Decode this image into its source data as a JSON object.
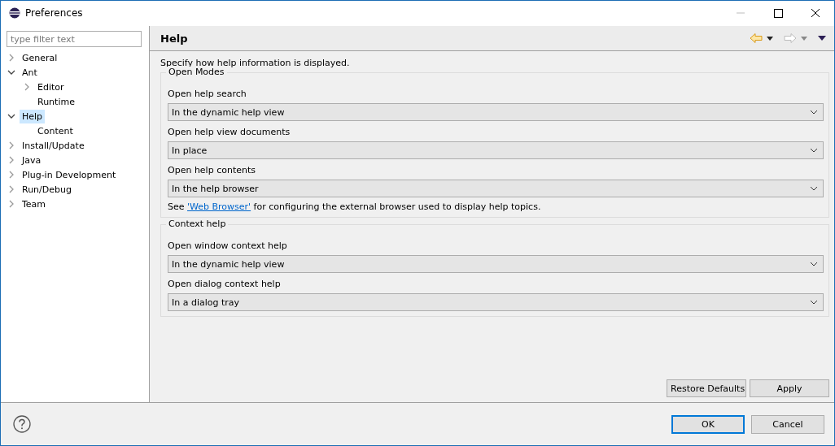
{
  "window": {
    "title": "Preferences"
  },
  "filter": {
    "placeholder": "type filter text"
  },
  "tree": [
    {
      "label": "General",
      "expandable": true,
      "expanded": false,
      "selected": false
    },
    {
      "label": "Ant",
      "expandable": true,
      "expanded": true,
      "selected": false,
      "children": [
        {
          "label": "Editor",
          "expandable": true,
          "expanded": false,
          "selected": false
        },
        {
          "label": "Runtime",
          "expandable": false,
          "expanded": false,
          "selected": false
        }
      ]
    },
    {
      "label": "Help",
      "expandable": true,
      "expanded": true,
      "selected": true,
      "children": [
        {
          "label": "Content",
          "expandable": false,
          "expanded": false,
          "selected": false
        }
      ]
    },
    {
      "label": "Install/Update",
      "expandable": true,
      "expanded": false,
      "selected": false
    },
    {
      "label": "Java",
      "expandable": true,
      "expanded": false,
      "selected": false
    },
    {
      "label": "Plug-in Development",
      "expandable": true,
      "expanded": false,
      "selected": false
    },
    {
      "label": "Run/Debug",
      "expandable": true,
      "expanded": false,
      "selected": false
    },
    {
      "label": "Team",
      "expandable": true,
      "expanded": false,
      "selected": false
    }
  ],
  "page": {
    "title": "Help",
    "description": "Specify how help information is displayed.",
    "groups": [
      {
        "legend": "Open Modes",
        "fields": [
          {
            "label": "Open help search",
            "value": "In the dynamic help view"
          },
          {
            "label": "Open help view documents",
            "value": "In place"
          },
          {
            "label": "Open help contents",
            "value": "In the help browser"
          }
        ],
        "note": {
          "before": "See ",
          "link": "'Web Browser'",
          "after": " for configuring the external browser used to display help topics."
        }
      },
      {
        "legend": "Context help",
        "fields": [
          {
            "label": "Open window context help",
            "value": "In the dynamic help view"
          },
          {
            "label": "Open dialog context help",
            "value": "In a dialog tray"
          }
        ]
      }
    ],
    "buttons": [
      "Restore Defaults",
      "Apply"
    ]
  },
  "dialog_buttons": [
    "OK",
    "Cancel"
  ]
}
